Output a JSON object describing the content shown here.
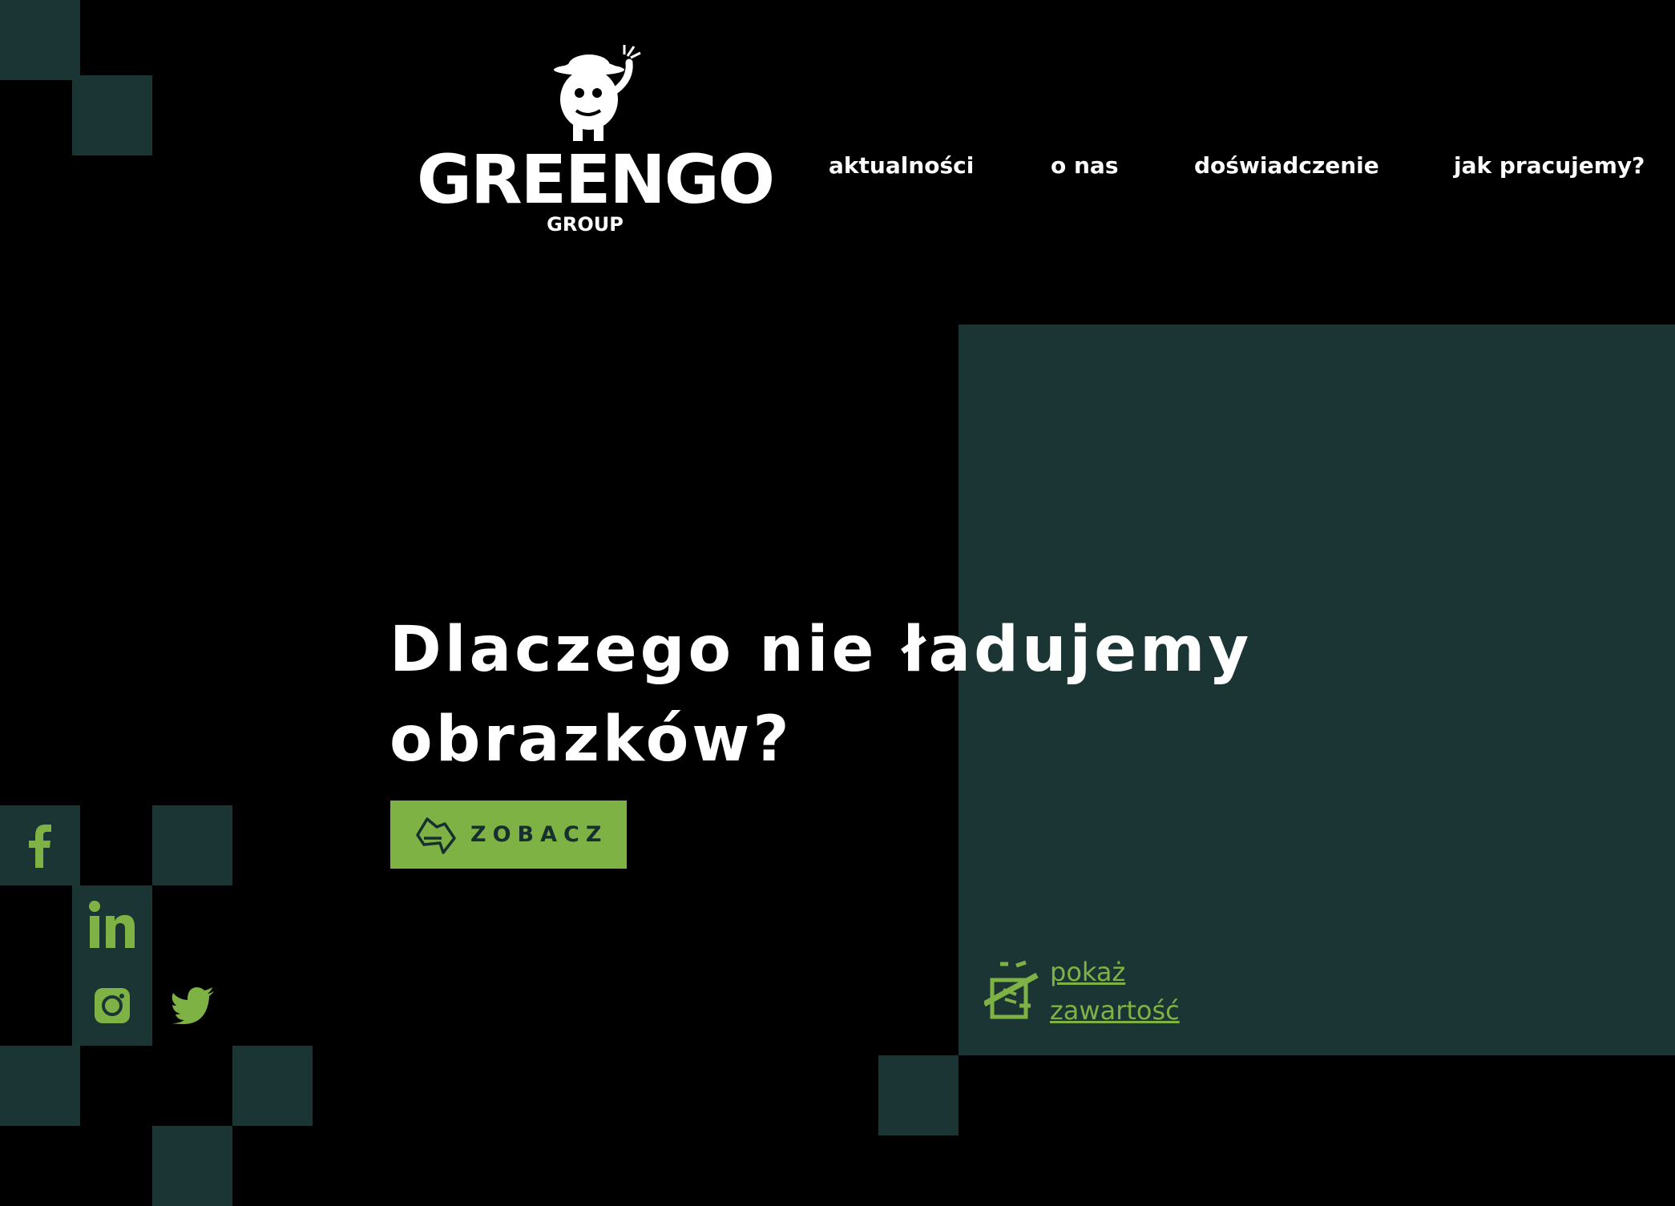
{
  "brand": {
    "name": "GREENGO",
    "sub": "GROUP"
  },
  "nav": {
    "items": [
      {
        "label": "aktualności"
      },
      {
        "label": "o nas"
      },
      {
        "label": "doświadczenie"
      },
      {
        "label": "jak pracujemy?"
      }
    ]
  },
  "hero": {
    "title_line1": "Dlaczego nie ładujemy",
    "title_line2": "obrazków?",
    "cta_label": "ZOBACZ"
  },
  "social": {
    "items": [
      {
        "name": "facebook",
        "icon": "facebook-icon"
      },
      {
        "name": "linkedin",
        "icon": "linkedin-icon"
      },
      {
        "name": "instagram",
        "icon": "instagram-icon"
      },
      {
        "name": "twitter",
        "icon": "twitter-icon"
      }
    ]
  },
  "show_content": {
    "line1": "pokaż",
    "line2": "zawartość",
    "icon": "mb-badge-icon"
  },
  "colors": {
    "background": "#000000",
    "tile": "#1b3535",
    "accent": "#7fb244",
    "text": "#ffffff"
  }
}
